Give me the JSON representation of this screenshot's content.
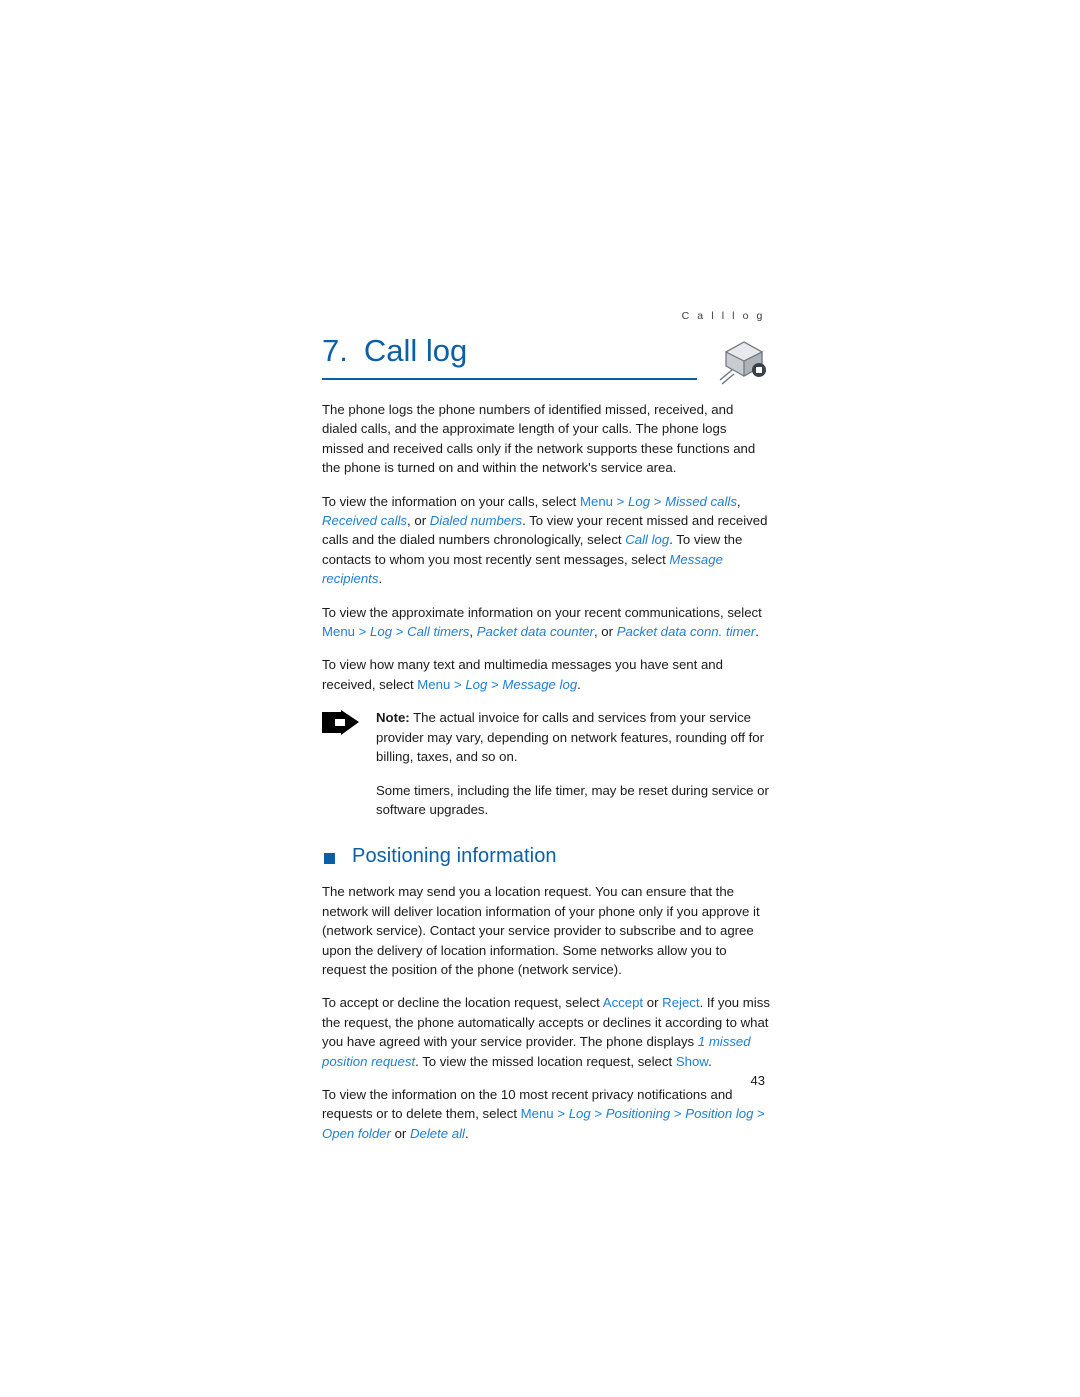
{
  "header": {
    "running_head": "C a l l   l o g"
  },
  "chapter": {
    "number": "7.",
    "title": "Call log",
    "icon": "call-log-icon"
  },
  "paragraphs": {
    "p1": "The phone logs the phone numbers of identified missed, received, and dialed calls, and the approximate length of your calls. The phone logs missed and received calls only if the network supports these functions and the phone is turned on and within the network's service area."
  },
  "p2": {
    "t1": "To view the information on your calls, select ",
    "menu": "Menu",
    "gt1": " > ",
    "log": "Log",
    "gt2": " > ",
    "missed": "Missed calls",
    "t2": ", ",
    "received": "Received calls",
    "t3": ", or ",
    "dialed": "Dialed numbers",
    "t4": ". To view your recent missed and received calls and the dialed numbers chronologically, select ",
    "calllog": "Call log",
    "t5": ". To view the contacts to whom you most recently sent messages, select ",
    "msgrec": "Message recipients",
    "t6": "."
  },
  "p3": {
    "t1": "To view the approximate information on your recent communications, select ",
    "menu": "Menu",
    "gt1": " > ",
    "log": "Log",
    "gt2": " > ",
    "calltimers": "Call timers",
    "t2": ", ",
    "packetdata": "Packet data counter",
    "t3": ", or ",
    "packetconn": "Packet data conn. timer",
    "t4": "."
  },
  "p4": {
    "t1": "To view how many text and multimedia messages you have sent and received, select ",
    "menu": "Menu",
    "gt1": " > ",
    "log": "Log",
    "gt2": " > ",
    "msglog": "Message log",
    "t2": "."
  },
  "note": {
    "icon": "note-arrow-icon",
    "label": "Note:",
    "text": " The actual invoice for calls and services from your service provider may vary, depending on network features, rounding off for billing, taxes, and so on.",
    "second": "Some timers, including the life timer, may be reset during service or software upgrades."
  },
  "section": {
    "title": "Positioning information",
    "bullet": "square-bullet-icon"
  },
  "p5": "The network may send you a location request. You can ensure that the network will deliver location information of your phone only if you approve it (network service). Contact your service provider to subscribe and to agree upon the delivery of location information. Some networks allow you to request the position of the phone (network service).",
  "p6": {
    "t1": "To accept or decline the location request, select ",
    "accept": "Accept",
    "t2": " or ",
    "reject": "Reject",
    "t3": ". If you miss the request, the phone automatically accepts or declines it according to what you have agreed with your service provider. The phone displays ",
    "missedpos": "1 missed position request",
    "t4": ". To view the missed location request, select ",
    "show": "Show",
    "t5": "."
  },
  "p7": {
    "t1": "To view the information on the 10 most recent privacy notifications and requests or to delete them, select ",
    "menu": "Menu",
    "gt1": " > ",
    "log": "Log",
    "gt2": " > ",
    "positioning": "Positioning",
    "gt3": " > ",
    "positionlog": "Position log",
    "gt4": " > ",
    "openfolder": "Open folder",
    "t2": " or ",
    "deleteall": "Delete all",
    "t3": "."
  },
  "footer": {
    "page_number": "43"
  }
}
